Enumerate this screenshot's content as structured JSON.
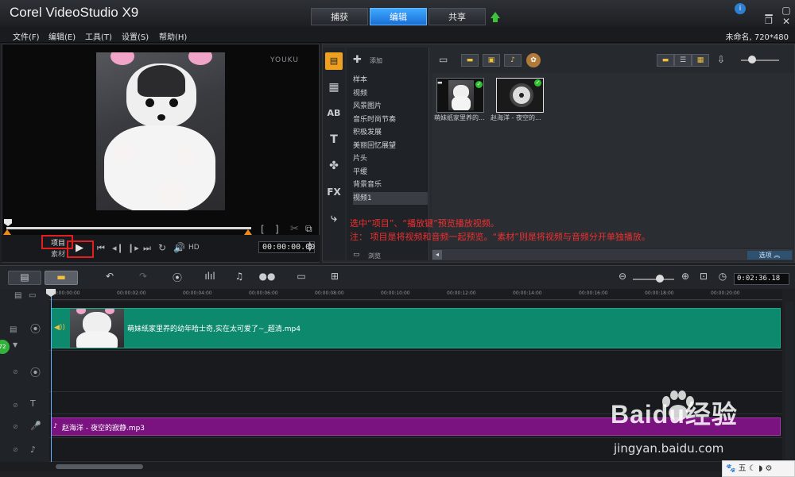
{
  "app": {
    "logo": "Corel VideoStudio X9"
  },
  "tabs": [
    {
      "label": "捕获"
    },
    {
      "label": "编辑"
    },
    {
      "label": "共享"
    }
  ],
  "menu": [
    "文件(F)",
    "编辑(E)",
    "工具(T)",
    "设置(S)",
    "帮助(H)"
  ],
  "project_info": "未命名, 720*480",
  "player": {
    "watermark": "YOUKU",
    "project_label": "项目",
    "clip_label": "素材",
    "hd_label": "HD",
    "timecode": "00:00:00.00",
    "bracket_in": "[",
    "bracket_out": "]"
  },
  "library": {
    "add_label": "添加",
    "folders": [
      "样本",
      "视频",
      "风景图片",
      "音乐时尚节奏",
      "积极发展",
      "美丽回忆展望",
      "片头",
      "平缓",
      "背景音乐",
      "视频1"
    ],
    "selected_folder": "视频1",
    "browse_label": "浏览",
    "options_label": "选项",
    "items": [
      {
        "caption": "萌妹纸家里养的..."
      },
      {
        "caption": "赵海洋 - 夜空的..."
      }
    ]
  },
  "annotation": {
    "line1": "选中“项目”、“播放键”预览播放视频。",
    "line2": "注：  项目是将视频和音频一起预览。“素材”则是将视频与音频分开单独播放。"
  },
  "timeline": {
    "total_time": "0:02:36.18",
    "ruler": [
      "00:00:00:00",
      "00:00:02:00",
      "00:00:04:00",
      "00:00:06:00",
      "00:00:08:00",
      "00:00:10:00",
      "00:00:12:00",
      "00:00:14:00",
      "00:00:16:00",
      "00:00:18:00",
      "00:00:20:00"
    ],
    "video_clip": "萌妹纸家里养的幼年哈士奇,实在太可爱了~_超清.mp4",
    "music_clip": "赵海洋 - 夜空的寂静.mp3",
    "badge": "72"
  },
  "watermark": {
    "logo": "Baidu经验",
    "url": "jingyan.baidu.com"
  },
  "ime": {
    "label": "五"
  },
  "colors": {
    "accent": "#1a6fd6",
    "video_clip": "#0d8a6e",
    "music_clip": "#7a137f",
    "annotation": "#f03030"
  }
}
